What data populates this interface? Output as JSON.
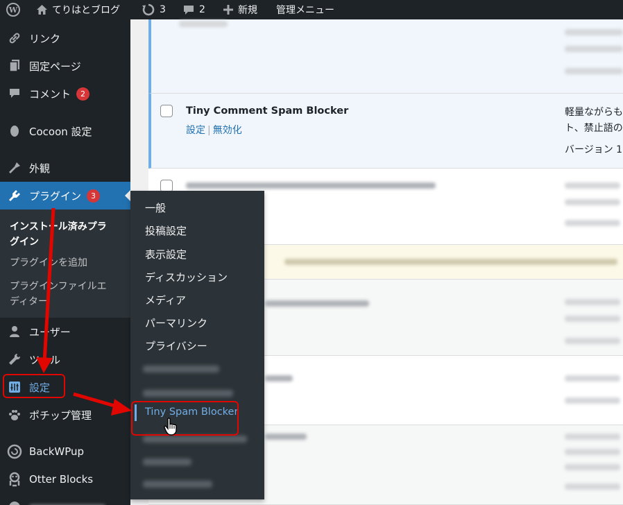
{
  "adminbar": {
    "site_name": "てりはとブログ",
    "updates_count": "3",
    "comments_count": "2",
    "new_label": "新規",
    "admin_menu_label": "管理メニュー",
    "icons": [
      "wordpress-logo-icon",
      "home-icon",
      "updates-icon",
      "comment-icon",
      "plus-icon"
    ]
  },
  "sidebar": {
    "items": [
      {
        "label": "リンク",
        "icon": "link-icon"
      },
      {
        "label": "固定ページ",
        "icon": "pages-icon"
      },
      {
        "label": "コメント",
        "icon": "comments-icon",
        "badge": "2"
      },
      {
        "label": "Cocoon 設定",
        "icon": "cocoon-icon"
      },
      {
        "label": "外観",
        "icon": "appearance-icon"
      },
      {
        "label": "プラグイン",
        "icon": "plugins-icon",
        "badge": "3"
      },
      {
        "label": "ユーザー",
        "icon": "users-icon"
      },
      {
        "label": "ツール",
        "icon": "tools-icon"
      },
      {
        "label": "設定",
        "icon": "settings-icon"
      },
      {
        "label": "ポチップ管理",
        "icon": "paw-icon"
      },
      {
        "label": "BackWPup",
        "icon": "backwpup-icon"
      },
      {
        "label": "Otter Blocks",
        "icon": "otter-icon"
      }
    ],
    "plugin_submenu": {
      "installed": "インストール済みプラ\nグイン",
      "add_new": "プラグインを追加",
      "editor": "プラグインファイルエ\nディター"
    }
  },
  "plugin_row": {
    "name": "Tiny Comment Spam Blocker",
    "action_settings": "設定",
    "action_separator": "|",
    "action_deactivate": "無効化",
    "desc_line1": "軽量ながらも",
    "desc_line2": "ト、禁止語の",
    "version_label": "バージョン 1"
  },
  "settings_flyout": {
    "items": [
      "一般",
      "投稿設定",
      "表示設定",
      "ディスカッション",
      "メディア",
      "パーマリンク",
      "プライバシー"
    ],
    "highlighted": "Tiny Spam Blocker"
  },
  "colors": {
    "admin_dark": "#1d2327",
    "submenu_bg": "#2c3338",
    "accent_blue": "#2271b1",
    "highlight_blue": "#72aee6",
    "badge_red": "#d63638",
    "annotation_red": "#e10600"
  }
}
